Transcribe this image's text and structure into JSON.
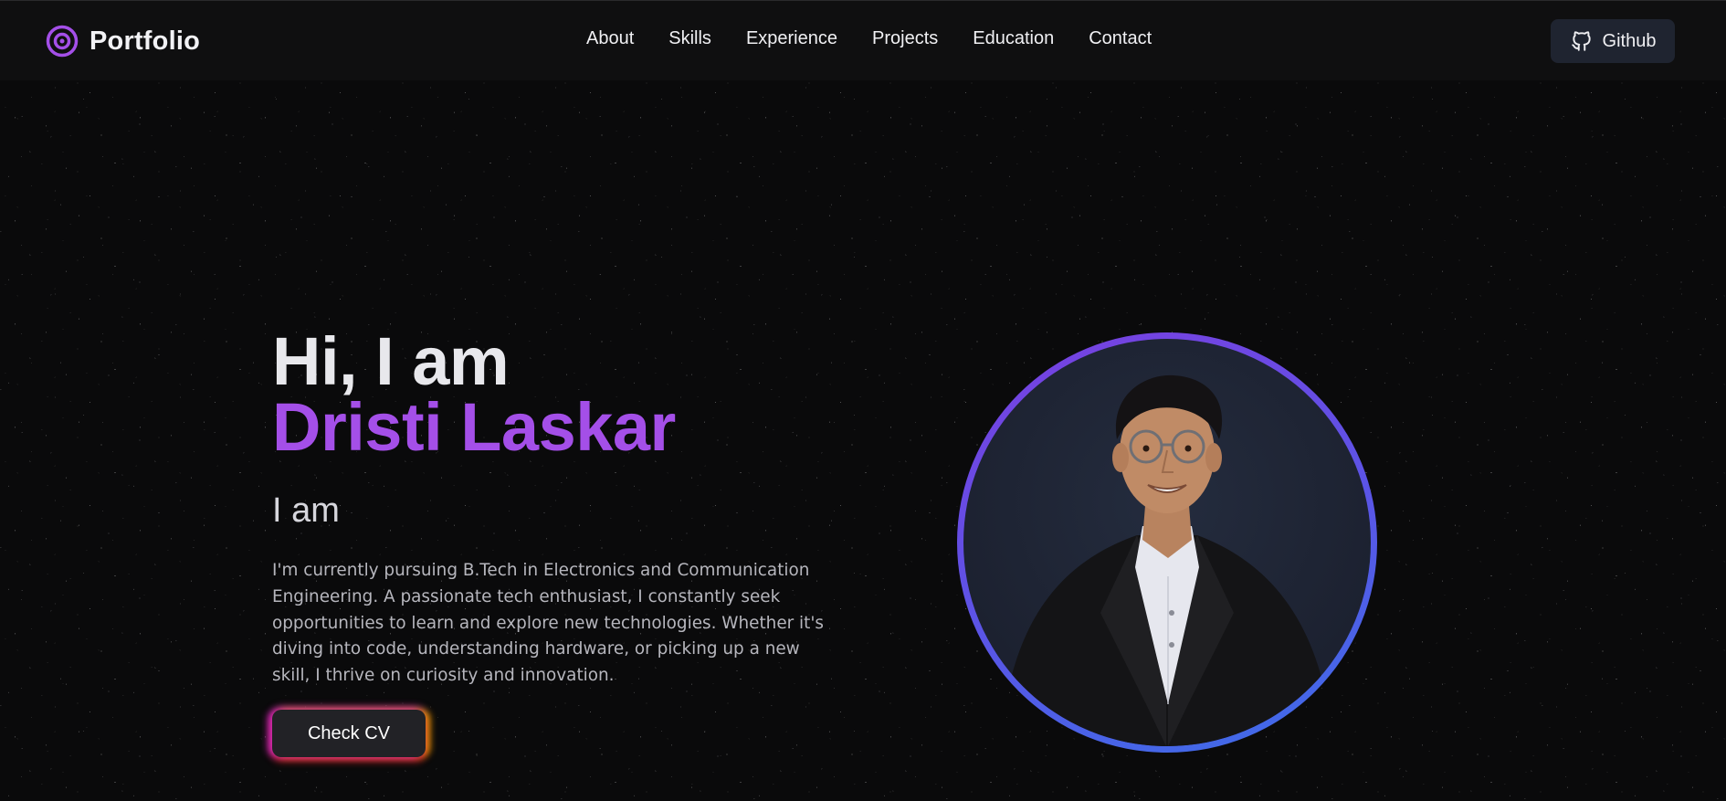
{
  "navbar": {
    "brand_title": "Portfolio",
    "brand_icon": "eye-logo-icon",
    "links": [
      "About",
      "Skills",
      "Experience",
      "Projects",
      "Education",
      "Contact"
    ],
    "github_label": "Github",
    "github_icon": "github-icon"
  },
  "hero": {
    "greeting": "Hi, I am",
    "name": "Dristi Laskar",
    "role_prefix": "I am",
    "bio": "I'm currently pursuing B.Tech in Electronics and Communication Engineering. A passionate tech enthusiast, I constantly seek opportunities to learn and explore new technologies. Whether it's diving into code, understanding hardware, or picking up a new skill, I thrive on curiosity and innovation.",
    "cv_button": "Check CV",
    "portrait_alt": "profile-photo"
  },
  "colors": {
    "accent": "#a44fe8",
    "background": "#0a0a0b",
    "nav_background": "#0f0f10",
    "github_button": "#1f2430",
    "ring_start": "#7a3fe0",
    "ring_end": "#3c6ee8"
  }
}
